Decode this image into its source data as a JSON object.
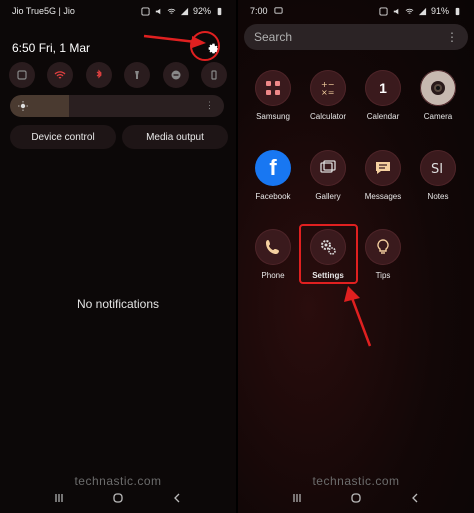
{
  "left": {
    "status": {
      "carrier": "Jio True5G | Jio",
      "battery": "92%"
    },
    "date_time": "6:50  Fri, 1 Mar",
    "device_control": "Device control",
    "media_output": "Media output",
    "no_notifications": "No notifications",
    "watermark": "technastic.com"
  },
  "right": {
    "status": {
      "time": "7:00",
      "battery": "91%"
    },
    "search": {
      "placeholder": "Search"
    },
    "apps": [
      {
        "label": "Samsung",
        "icon": "samsung-folder-icon"
      },
      {
        "label": "Calculator",
        "icon": "calculator-icon"
      },
      {
        "label": "Calendar",
        "icon": "calendar-icon",
        "day": "1"
      },
      {
        "label": "Camera",
        "icon": "camera-icon"
      },
      {
        "label": "Facebook",
        "icon": "facebook-icon",
        "glyph": "f"
      },
      {
        "label": "Gallery",
        "icon": "gallery-icon"
      },
      {
        "label": "Messages",
        "icon": "messages-icon"
      },
      {
        "label": "Notes",
        "icon": "notes-icon"
      },
      {
        "label": "Phone",
        "icon": "phone-icon"
      },
      {
        "label": "Settings",
        "icon": "settings-gear-icon"
      },
      {
        "label": "Tips",
        "icon": "tips-bulb-icon"
      }
    ],
    "watermark": "technastic.com"
  },
  "colors": {
    "highlight_red": "#e02020",
    "accent_dark_red": "#3a1a1d"
  }
}
